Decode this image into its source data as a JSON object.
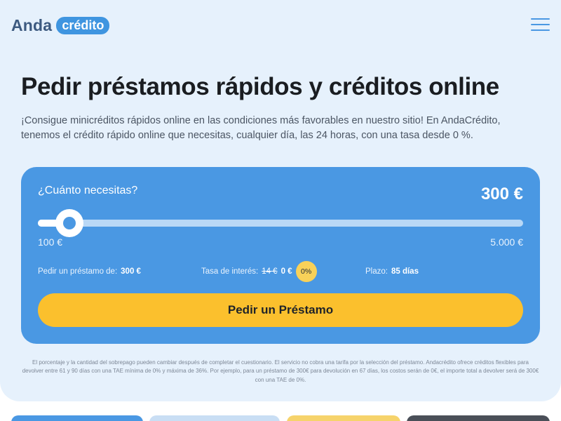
{
  "header": {
    "logo_word": "Anda",
    "logo_badge": "crédito",
    "menu_icon": "hamburger-menu-icon"
  },
  "hero": {
    "title": "Pedir préstamos rápidos y créditos online",
    "intro": "¡Consigue minicréditos rápidos online en las condiciones más favorables en nuestro sitio! En AndaCrédito, tenemos el crédito rápido online que necesitas, cualquier día, las 24 horas, con una tasa desde 0 %."
  },
  "calculator": {
    "question": "¿Cuánto necesitas?",
    "amount_display": "300 €",
    "slider": {
      "min": 100,
      "max": 5000,
      "value": 300
    },
    "min_label": "100 €",
    "max_label": "5.000 €",
    "loan_label": "Pedir un préstamo de:",
    "loan_value": "300 €",
    "interest_label": "Tasa de interés:",
    "interest_old": "14 €",
    "interest_new": "0 €",
    "interest_badge": "0%",
    "term_label": "Plazo:",
    "term_value": "85 días",
    "cta_label": "Pedir un Préstamo"
  },
  "disclaimer": "El porcentaje y la cantidad del sobrepago pueden cambiar después de completar el cuestionario. El servicio no cobra una tarifa por la selección del préstamo. Andacrédito ofrece créditos flexibles para devolver entre 61 y 90 días con una TAE mínima de 0% y máxima de 36%. Por ejemplo, para un préstamo de 300€ para devolución en 67 días, los costos serán de 0€, el importe total a devolver será de 300€ con una TAE de 0%.",
  "colors": {
    "primary": "#4a98e3",
    "hero_bg": "#e6f1fc",
    "cta": "#fbc02d",
    "badge": "#f8d159",
    "logo_text": "#3d5a80"
  }
}
